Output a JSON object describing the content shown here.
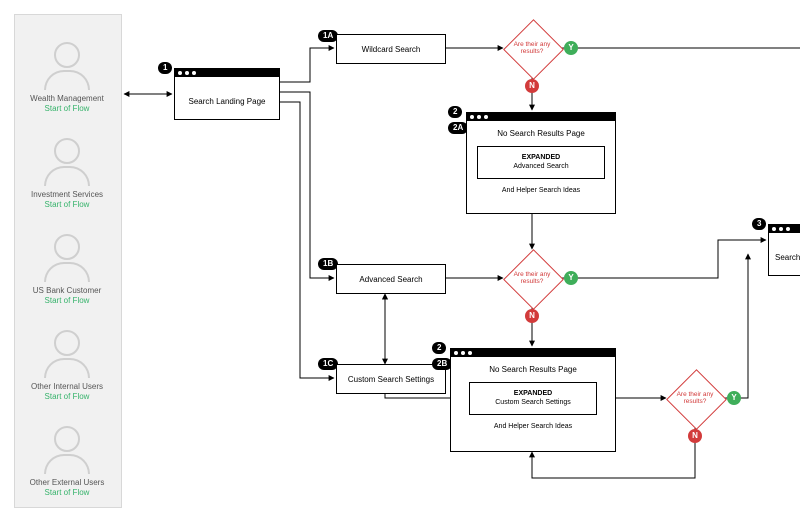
{
  "personas": [
    {
      "name": "Wealth Management",
      "link": "Start of Flow"
    },
    {
      "name": "Investment Services",
      "link": "Start of Flow"
    },
    {
      "name": "US Bank Customer",
      "link": "Start of Flow"
    },
    {
      "name": "Other Internal Users",
      "link": "Start of Flow"
    },
    {
      "name": "Other External Users",
      "link": "Start of Flow"
    }
  ],
  "steps": {
    "s1": "1",
    "s1a": "1A",
    "s1b": "1B",
    "s1c": "1C",
    "s2_top": "2",
    "s2a": "2A",
    "s2_bot": "2",
    "s2b": "2B",
    "s3": "3"
  },
  "boxes": {
    "landing": "Search Landing Page",
    "wildcard": "Wildcard Search",
    "advanced": "Advanced Search",
    "custom": "Custom Search Settings",
    "results": "Search"
  },
  "panels": {
    "no_results_title": "No Search Results Page",
    "exp_label": "EXPANDED",
    "exp_adv": "Advanced Search",
    "exp_custom": "Custom Search Settings",
    "helper": "And Helper Search Ideas"
  },
  "decision": {
    "q": "Are their any results?",
    "y": "Y",
    "n": "N"
  }
}
